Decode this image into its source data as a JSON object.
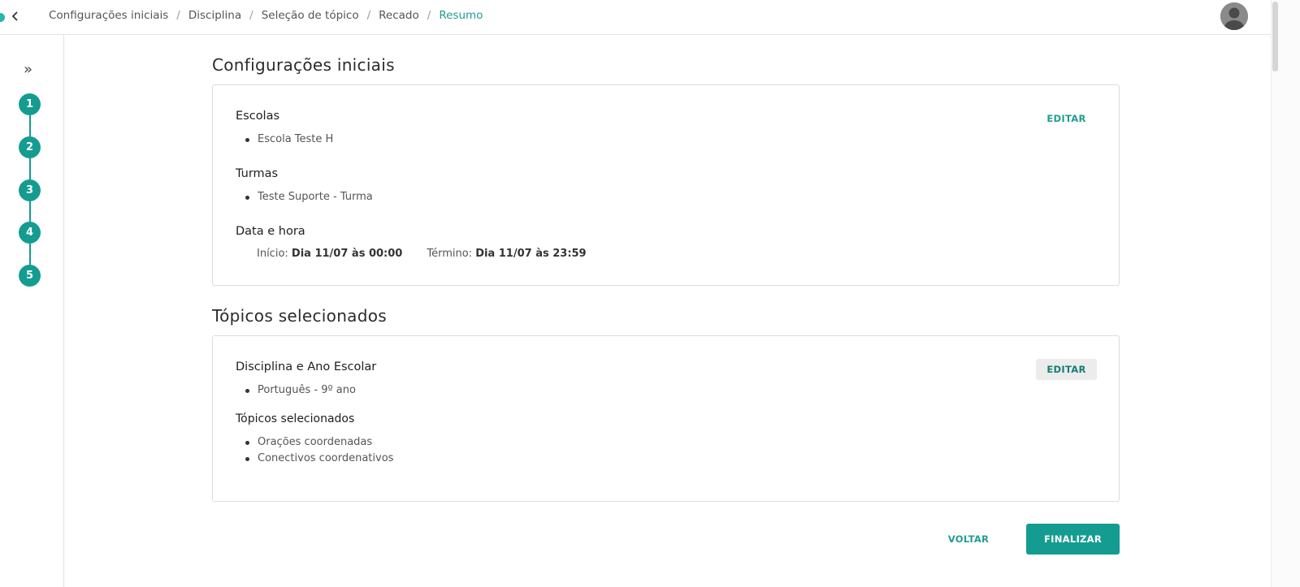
{
  "breadcrumb": [
    {
      "label": "Configurações iniciais"
    },
    {
      "label": "Disciplina"
    },
    {
      "label": "Seleção de tópico"
    },
    {
      "label": "Recado"
    },
    {
      "label": "Resumo"
    }
  ],
  "breadcrumb_separator": "/",
  "sidebar": {
    "expand_glyph": "»",
    "steps": [
      "1",
      "2",
      "3",
      "4",
      "5"
    ]
  },
  "config": {
    "title": "Configurações iniciais",
    "edit_label": "EDITAR",
    "escolas_heading": "Escolas",
    "escolas": [
      "Escola Teste H"
    ],
    "turmas_heading": "Turmas",
    "turmas": [
      "Teste Suporte - Turma"
    ],
    "datetime_heading": "Data e hora",
    "start_label": "Início:",
    "start_value": "Dia 11/07 às 00:00",
    "end_label": "Término:",
    "end_value": "Dia 11/07 às 23:59"
  },
  "topics": {
    "title": "Tópicos selecionados",
    "edit_label": "EDITAR",
    "discipline_heading": "Disciplina e Ano Escolar",
    "disciplines": [
      "Português - 9º ano"
    ],
    "topics_heading": "Tópicos selecionados",
    "topics": [
      "Orações coordenadas",
      "Conectivos coordenativos"
    ]
  },
  "actions": {
    "back_label": "VOLTAR",
    "finish_label": "FINALIZAR"
  },
  "colors": {
    "accent": "#159c90",
    "accent_text": "#1f9d91"
  },
  "icons": {
    "back": "chevron-left-icon",
    "avatar": "user-avatar-icon",
    "expand": "double-chevron-right-icon"
  }
}
